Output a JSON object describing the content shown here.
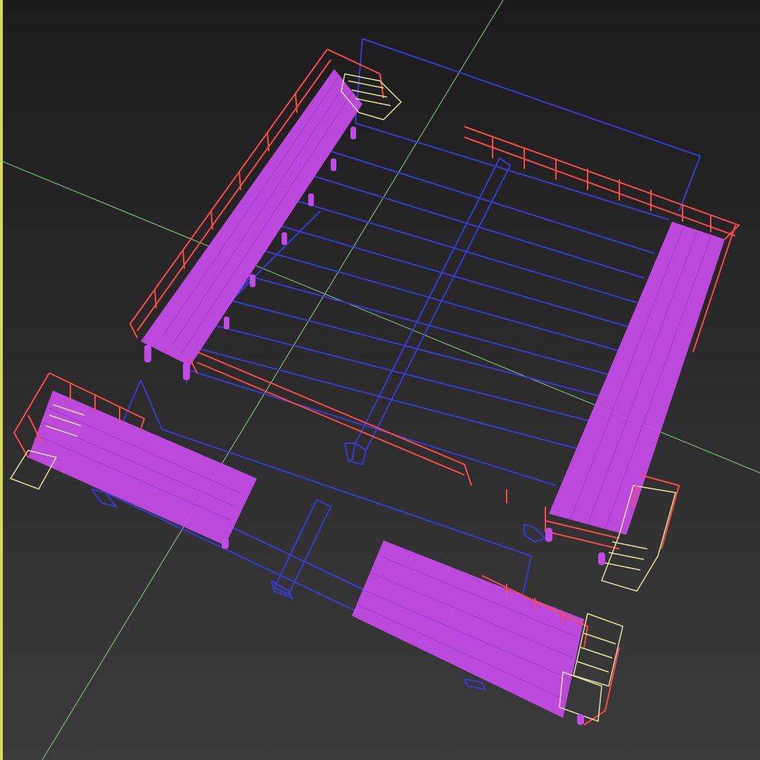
{
  "viewport": {
    "view": "perspective",
    "render_mode": "wireframe",
    "active": true
  },
  "colors": {
    "background_top": "#1c1c1c",
    "background_bottom": "#3b3b3b",
    "active_border": "#d7d95a",
    "grid_axis": "#8fd18a",
    "frame": "#3a3ad6",
    "deck": "#c24be6",
    "railing": "#ff4a4a",
    "stairs": "#e8e4a2"
  },
  "objects": [
    {
      "name": "main-frame",
      "kind": "frame"
    },
    {
      "name": "walkway-left",
      "kind": "deck"
    },
    {
      "name": "walkway-right",
      "kind": "deck"
    },
    {
      "name": "platform-lower-left",
      "kind": "deck"
    },
    {
      "name": "platform-lower-right",
      "kind": "deck"
    },
    {
      "name": "center-column",
      "kind": "frame"
    },
    {
      "name": "stairs",
      "kind": "stairs"
    }
  ]
}
